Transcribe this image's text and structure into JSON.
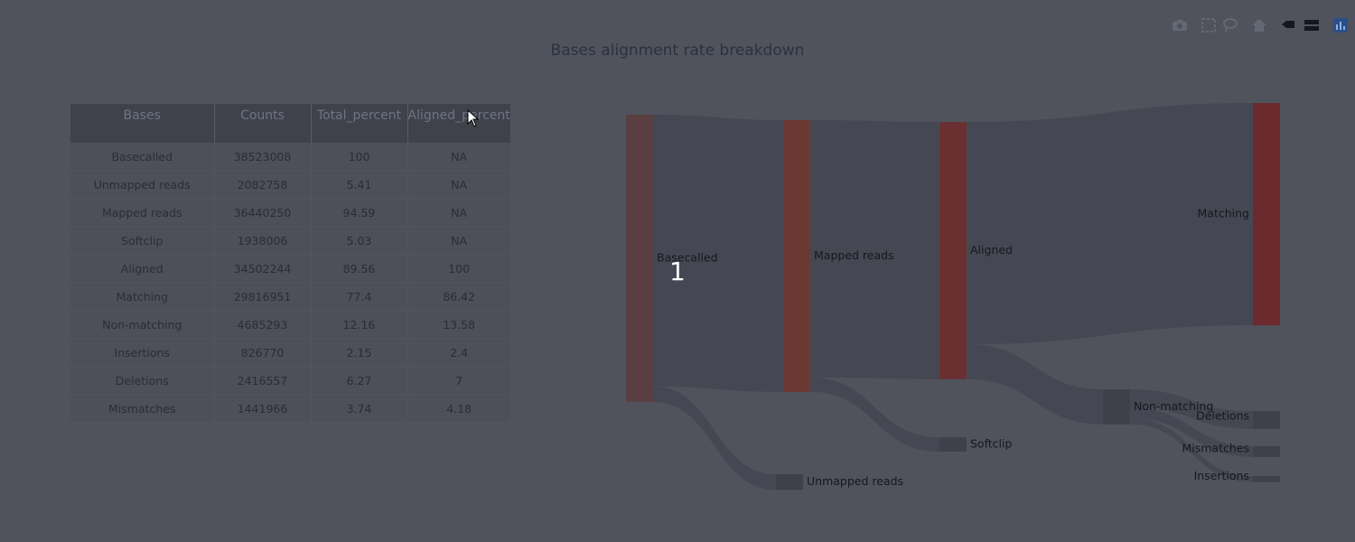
{
  "chart_data": [
    {
      "type": "table",
      "columns": [
        "Bases",
        "Counts",
        "Total_percent",
        "Aligned_percent"
      ],
      "rows": [
        [
          "Basecalled",
          "38523008",
          "100",
          "NA"
        ],
        [
          "Unmapped reads",
          "2082758",
          "5.41",
          "NA"
        ],
        [
          "Mapped reads",
          "36440250",
          "94.59",
          "NA"
        ],
        [
          "Softclip",
          "1938006",
          "5.03",
          "NA"
        ],
        [
          "Aligned",
          "34502244",
          "89.56",
          "100"
        ],
        [
          "Matching",
          "29816951",
          "77.4",
          "86.42"
        ],
        [
          "Non-matching",
          "4685293",
          "12.16",
          "13.58"
        ],
        [
          "Insertions",
          "826770",
          "2.15",
          "2.4"
        ],
        [
          "Deletions",
          "2416557",
          "6.27",
          "7"
        ],
        [
          "Mismatches",
          "1441966",
          "3.74",
          "4.18"
        ]
      ]
    },
    {
      "type": "sankey",
      "nodes": [
        {
          "id": "basecalled",
          "label": "Basecalled",
          "color": "#5a3e42"
        },
        {
          "id": "mapped",
          "label": "Mapped reads",
          "color": "#6b3932"
        },
        {
          "id": "unmapped",
          "label": "Unmapped reads",
          "color": "#3e414a"
        },
        {
          "id": "aligned",
          "label": "Aligned",
          "color": "#6a2f31"
        },
        {
          "id": "softclip",
          "label": "Softclip",
          "color": "#3e414a"
        },
        {
          "id": "matching",
          "label": "Matching",
          "color": "#6a2a2e"
        },
        {
          "id": "nonmatching",
          "label": "Non-matching",
          "color": "#3e414a"
        },
        {
          "id": "deletions",
          "label": "Deletions",
          "color": "#3e414a"
        },
        {
          "id": "mismatches",
          "label": "Mismatches",
          "color": "#3e414a"
        },
        {
          "id": "insertions",
          "label": "Insertions",
          "color": "#3e414a"
        }
      ],
      "links": [
        {
          "source": "basecalled",
          "target": "mapped",
          "value": 36440250
        },
        {
          "source": "basecalled",
          "target": "unmapped",
          "value": 2082758
        },
        {
          "source": "mapped",
          "target": "aligned",
          "value": 34502244
        },
        {
          "source": "mapped",
          "target": "softclip",
          "value": 1938006
        },
        {
          "source": "aligned",
          "target": "matching",
          "value": 29816951
        },
        {
          "source": "aligned",
          "target": "nonmatching",
          "value": 4685293
        },
        {
          "source": "nonmatching",
          "target": "deletions",
          "value": 2416557
        },
        {
          "source": "nonmatching",
          "target": "mismatches",
          "value": 1441966
        },
        {
          "source": "nonmatching",
          "target": "insertions",
          "value": 826770
        }
      ],
      "link_color": "#454852",
      "annotation": "1"
    }
  ],
  "title": "Bases alignment rate breakdown",
  "modebar": [
    "camera-icon",
    "box-select-icon",
    "lasso-icon",
    "home-icon",
    "spike-lines-icon",
    "compare-data-icon",
    "plotly-logo-icon"
  ]
}
